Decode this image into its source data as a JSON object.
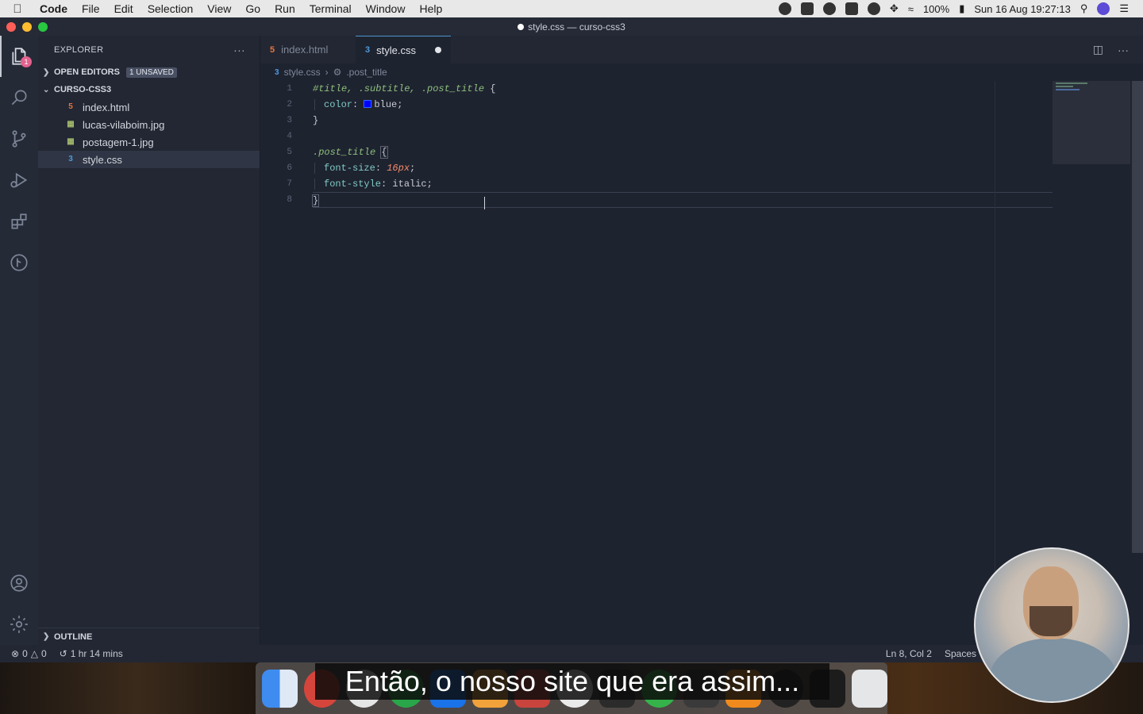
{
  "menubar": {
    "app_name": "Code",
    "items": [
      "File",
      "Edit",
      "Selection",
      "View",
      "Go",
      "Run",
      "Terminal",
      "Window",
      "Help"
    ],
    "battery": "100%",
    "datetime": "Sun 16 Aug  19:27:13"
  },
  "window": {
    "title": "style.css — curso-css3"
  },
  "activity": {
    "badge": "1"
  },
  "sidebar": {
    "header": "EXPLORER",
    "more": "···",
    "open_editors": "OPEN EDITORS",
    "unsaved": "1 UNSAVED",
    "folder": "CURSO-CSS3",
    "files": [
      {
        "name": "index.html",
        "icon": "html-file-icon"
      },
      {
        "name": "lucas-vilaboim.jpg",
        "icon": "image-file-icon"
      },
      {
        "name": "postagem-1.jpg",
        "icon": "image-file-icon"
      },
      {
        "name": "style.css",
        "icon": "css-file-icon"
      }
    ],
    "outline": "OUTLINE"
  },
  "tabs": [
    {
      "label": "index.html"
    },
    {
      "label": "style.css"
    }
  ],
  "breadcrumb": {
    "file": "style.css",
    "symbol": ".post_title"
  },
  "editor": {
    "line_numbers": [
      "1",
      "2",
      "3",
      "4",
      "5",
      "6",
      "7",
      "8"
    ],
    "l1_sel": "#title, .subtitle, .post_title",
    "l1_brace": " {",
    "l2_prop": "color",
    "l2_val": "blue",
    "l3": "}",
    "l5_sel": ".post_title",
    "l5_brace": "{",
    "l6_prop": "font-size",
    "l6_val": "16px",
    "l7_prop": "font-style",
    "l7_val": "italic",
    "l8": "}"
  },
  "statusbar": {
    "errors": "0",
    "warnings": "0",
    "time": "1 hr 14 mins",
    "position": "Ln 8, Col 2",
    "spaces": "Spaces"
  },
  "caption": "Então, o nosso site que era assim..."
}
